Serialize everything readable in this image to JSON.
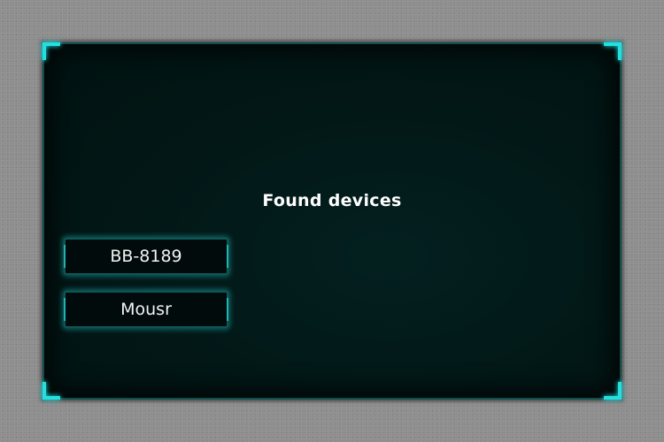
{
  "dialog": {
    "title": "Found devices",
    "devices": [
      {
        "label": "BB-8189"
      },
      {
        "label": "Mousr"
      }
    ]
  },
  "colors": {
    "accent": "#22e0e0",
    "panel_bg": "#021716",
    "page_bg": "#8e8e8e"
  }
}
